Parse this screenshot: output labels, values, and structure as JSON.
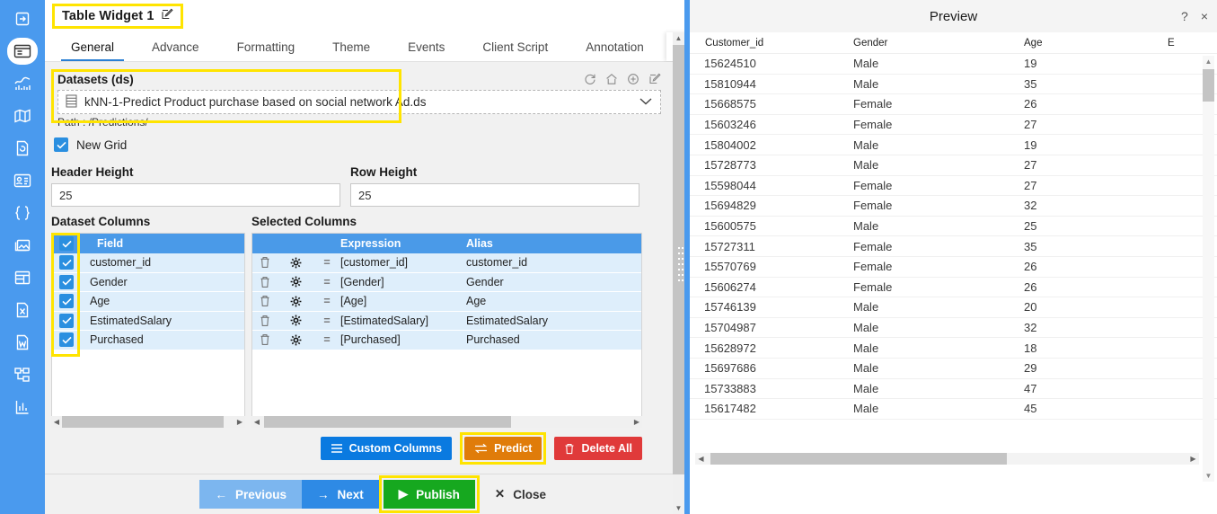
{
  "rail": {
    "items": [
      {
        "name": "export-icon",
        "active": false
      },
      {
        "name": "dashboard-icon",
        "active": true
      },
      {
        "name": "chart-icon",
        "active": false
      },
      {
        "name": "map-icon",
        "active": false
      },
      {
        "name": "document-refresh-icon",
        "active": false
      },
      {
        "name": "card-icon",
        "active": false
      },
      {
        "name": "code-braces-icon",
        "active": false
      },
      {
        "name": "image-icon",
        "active": false
      },
      {
        "name": "grid-icon",
        "active": false
      },
      {
        "name": "excel-file-icon",
        "active": false
      },
      {
        "name": "word-file-icon",
        "active": false
      },
      {
        "name": "hierarchy-icon",
        "active": false
      },
      {
        "name": "report-chart-icon",
        "active": false
      }
    ]
  },
  "window": {
    "title": "Table Widget 1",
    "edit_icon": "pencil-square-icon",
    "help_glyph": "?",
    "close_glyph": "×"
  },
  "tabs": {
    "items": [
      {
        "label": "General",
        "active": true
      },
      {
        "label": "Advance",
        "active": false
      },
      {
        "label": "Formatting",
        "active": false
      },
      {
        "label": "Theme",
        "active": false
      },
      {
        "label": "Events",
        "active": false
      },
      {
        "label": "Client Script",
        "active": false
      },
      {
        "label": "Annotation",
        "active": false
      }
    ],
    "next_glyph": "›"
  },
  "datasets": {
    "label": "Datasets (ds)",
    "selected": "kNN-1-Predict Product purchase based on social network Ad.ds",
    "path": "Path : /Predictions/",
    "chevron": "⌄",
    "toolbar_icons": [
      "refresh-icon",
      "home-icon",
      "add-circle-icon",
      "edit-icon"
    ]
  },
  "options": {
    "new_grid_label": "New Grid",
    "new_grid_checked": true,
    "header_height_label": "Header Height",
    "header_height_value": "25",
    "row_height_label": "Row Height",
    "row_height_value": "25"
  },
  "dataset_columns": {
    "title": "Dataset Columns",
    "header": "Field",
    "rows": [
      {
        "field": "customer_id",
        "checked": true
      },
      {
        "field": "Gender",
        "checked": true
      },
      {
        "field": "Age",
        "checked": true
      },
      {
        "field": "EstimatedSalary",
        "checked": true
      },
      {
        "field": "Purchased",
        "checked": true
      }
    ]
  },
  "selected_columns": {
    "title": "Selected Columns",
    "headers": {
      "expression": "Expression",
      "alias": "Alias"
    },
    "rows": [
      {
        "expression": "[customer_id]",
        "alias": "customer_id"
      },
      {
        "expression": "[Gender]",
        "alias": "Gender"
      },
      {
        "expression": "[Age]",
        "alias": "Age"
      },
      {
        "expression": "[EstimatedSalary]",
        "alias": "EstimatedSalary"
      },
      {
        "expression": "[Purchased]",
        "alias": "Purchased"
      }
    ],
    "row_icons": {
      "delete": "trash-icon",
      "settings": "gear-icon",
      "equals": "="
    }
  },
  "actions": {
    "custom_columns": "Custom Columns",
    "predict": "Predict",
    "delete_all": "Delete All"
  },
  "footer": {
    "previous": "Previous",
    "next": "Next",
    "publish": "Publish",
    "close": "Close"
  },
  "preview": {
    "title": "Preview",
    "columns": [
      "Customer_id",
      "Gender",
      "Age",
      "E"
    ],
    "rows": [
      {
        "customer_id": "15624510",
        "gender": "Male",
        "age": "19"
      },
      {
        "customer_id": "15810944",
        "gender": "Male",
        "age": "35"
      },
      {
        "customer_id": "15668575",
        "gender": "Female",
        "age": "26"
      },
      {
        "customer_id": "15603246",
        "gender": "Female",
        "age": "27"
      },
      {
        "customer_id": "15804002",
        "gender": "Male",
        "age": "19"
      },
      {
        "customer_id": "15728773",
        "gender": "Male",
        "age": "27"
      },
      {
        "customer_id": "15598044",
        "gender": "Female",
        "age": "27"
      },
      {
        "customer_id": "15694829",
        "gender": "Female",
        "age": "32"
      },
      {
        "customer_id": "15600575",
        "gender": "Male",
        "age": "25"
      },
      {
        "customer_id": "15727311",
        "gender": "Female",
        "age": "35"
      },
      {
        "customer_id": "15570769",
        "gender": "Female",
        "age": "26"
      },
      {
        "customer_id": "15606274",
        "gender": "Female",
        "age": "26"
      },
      {
        "customer_id": "15746139",
        "gender": "Male",
        "age": "20"
      },
      {
        "customer_id": "15704987",
        "gender": "Male",
        "age": "32"
      },
      {
        "customer_id": "15628972",
        "gender": "Male",
        "age": "18"
      },
      {
        "customer_id": "15697686",
        "gender": "Male",
        "age": "29"
      },
      {
        "customer_id": "15733883",
        "gender": "Male",
        "age": "47"
      },
      {
        "customer_id": "15617482",
        "gender": "Male",
        "age": "45"
      }
    ]
  },
  "colors": {
    "accent_blue": "#4a9aee",
    "highlight_yellow": "#ffe400",
    "table_header_blue": "#4a9ae8",
    "publish_green": "#16a81f",
    "predict_orange": "#e07c0a",
    "delete_red": "#e03a3a",
    "custom_blue": "#0a7ae0"
  }
}
